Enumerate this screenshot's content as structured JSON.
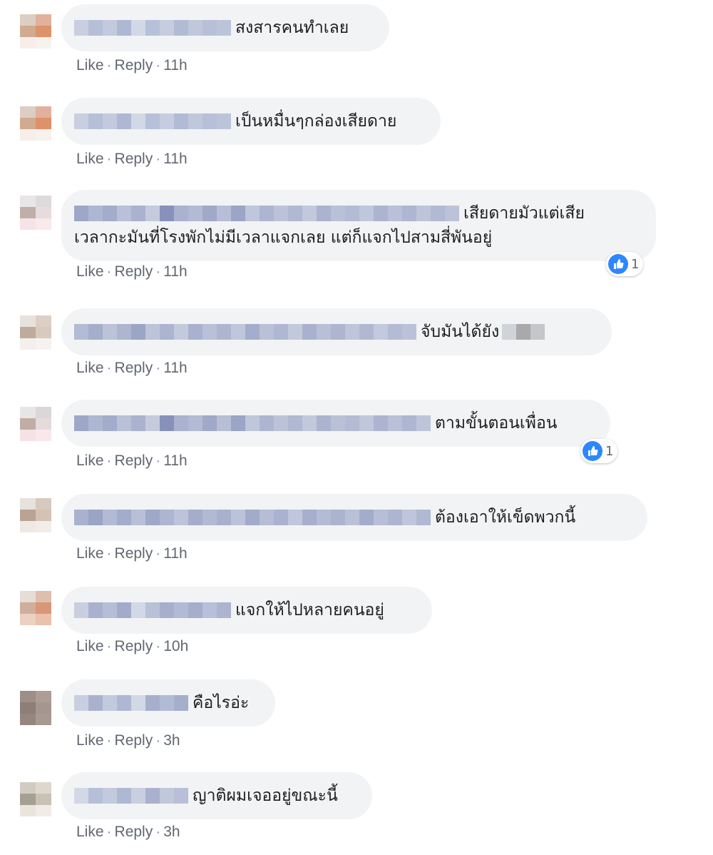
{
  "colors": {
    "bubble": "#f2f3f5",
    "action_text": "#616770",
    "like_blue": "#2d88ff"
  },
  "action_labels": {
    "like": "Like",
    "reply": "Reply",
    "separator": "·"
  },
  "comments": [
    {
      "text": [
        "สงสารคนทำเลย"
      ],
      "time": "11h"
    },
    {
      "text": [
        "เป็นหมื่นๆกล่องเสียดาย"
      ],
      "time": "11h"
    },
    {
      "text": [
        "เสียดายมัวแต่เสีย",
        "เวลากะมันที่โรงพักไม่มีเวลาแจกเลย แต่ก็แจกไปสามสี่พันอยู่"
      ],
      "time": "11h",
      "reaction_icon": "like-icon",
      "reaction_count": "1"
    },
    {
      "text": [
        "จับมันได้ยัง"
      ],
      "time": "11h"
    },
    {
      "text": [
        "ตามขั้นตอนเพื่อน"
      ],
      "time": "11h",
      "reaction_icon": "like-icon",
      "reaction_count": "1"
    },
    {
      "text": [
        "ต้องเอาให้เข็ดพวกนี้"
      ],
      "time": "11h"
    },
    {
      "text": [
        "แจกให้ไปหลายคนอยู่"
      ],
      "time": "10h"
    },
    {
      "text": [
        "คือไรอ่ะ"
      ],
      "time": "3h"
    },
    {
      "text": [
        "ญาติผมเจออยู่ขณะนี้"
      ],
      "time": "3h"
    }
  ]
}
